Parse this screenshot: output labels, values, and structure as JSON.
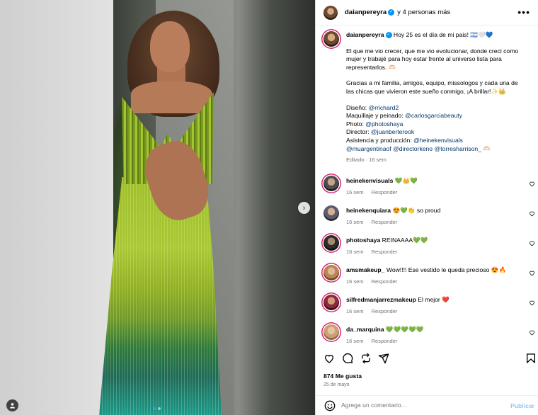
{
  "header": {
    "username": "daianpereyra",
    "others": "y 4 personas más",
    "more_icon": "more-horizontal-icon"
  },
  "caption": {
    "username": "daianpereyra",
    "line1": "Hoy 25 es el día de mi pais! 🇦🇷🤍💙",
    "para2": "El que me vio crecer, que me vio evolucionar, donde creci como mujer y trabajé para hoy estar frente al universo lista para representarlos. 🫶🏻",
    "para3": "Gracias a mi familia, amigos, equipo, missologos y cada una de las chicas que vivieron este sueño conmigo, ¡A brillar!✨👑",
    "credits": [
      {
        "label": "Diseño:",
        "handle": "@rrichard2"
      },
      {
        "label": "Maquillaje y peinado:",
        "handle": "@carlosgarciabeauty"
      },
      {
        "label": "Photo:",
        "handle": "@photoshaya"
      },
      {
        "label": "Director:",
        "handle": "@juanberterook"
      },
      {
        "label": "Asistencia y producción:",
        "handle": "@heinekenvisuals"
      }
    ],
    "credits_extra": [
      "@muargentinaof",
      "@directorkeno",
      "@torresharrison_"
    ],
    "credits_extra_emoji": " 🫶🏻",
    "meta": "Editado · 16 sem"
  },
  "comments": [
    {
      "user": "heinekenvisuals",
      "text": "💚👑💚",
      "time": "16 sem",
      "reply": "Responder"
    },
    {
      "user": "heinekenquiara",
      "text": "😍💚👏  so proud",
      "time": "16 sem",
      "reply": "Responder"
    },
    {
      "user": "photoshaya",
      "text": "REINAAAA💚💚",
      "time": "16 sem",
      "reply": "Responder"
    },
    {
      "user": "amsmakeup_",
      "text": "Wow!!!! Ese vestido le queda precioso 😍🔥",
      "time": "16 sem",
      "reply": "Responder"
    },
    {
      "user": "silfredmanjarrezmakeup",
      "text": "El mejor ❤️",
      "time": "16 sem",
      "reply": "Responder"
    },
    {
      "user": "da_marquina",
      "text": "💚💚💚💚💚",
      "time": "16 sem",
      "reply": "Responder"
    }
  ],
  "likes": "874 Me gusta",
  "date": "25 de mayo",
  "comment_box": {
    "placeholder": "Agrega un comentario...",
    "post_label": "Publicar"
  },
  "colors": {
    "accent": "#0095f6",
    "link": "#00376b",
    "muted": "#737373",
    "post_disabled": "#8fc7f5"
  },
  "media": {
    "slide_count": 2,
    "active_slide": 1
  }
}
